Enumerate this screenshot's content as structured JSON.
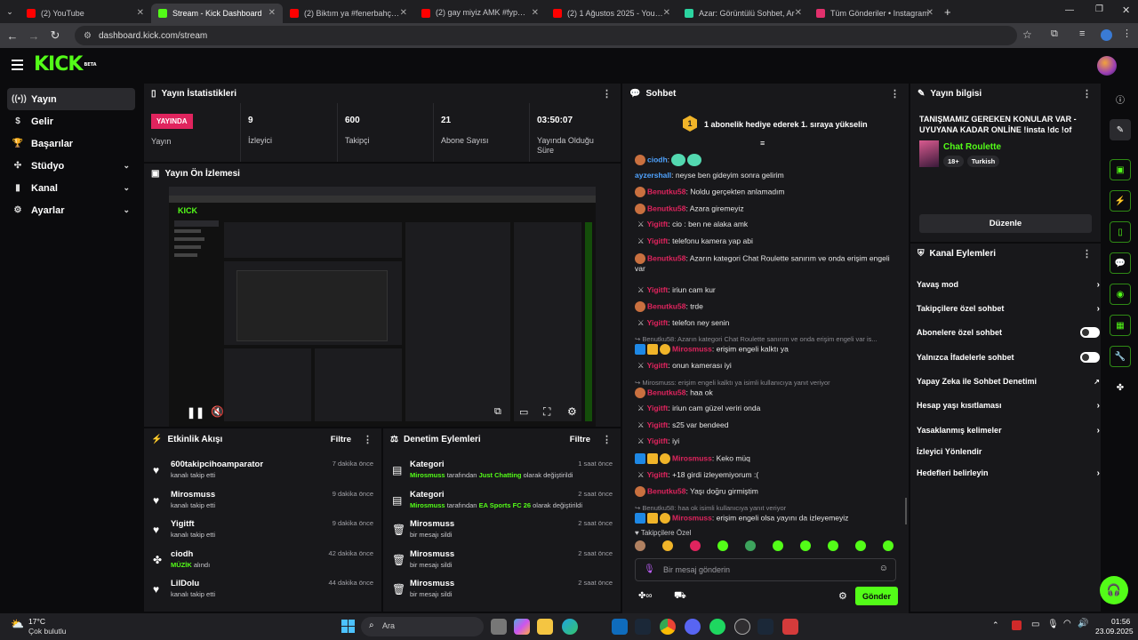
{
  "browser": {
    "tabs": [
      {
        "title": "(2) YouTube",
        "color": "#ff0000"
      },
      {
        "title": "Stream - Kick Dashboard",
        "color": "#53fc18"
      },
      {
        "title": "(2) Biktım ya #fenerbahçe #derı",
        "color": "#ff0000"
      },
      {
        "title": "(2) gay miyiz AMK #fyp🎶#viral",
        "color": "#ff0000"
      },
      {
        "title": "(2) 1 Ağustos 2025 - YouTube",
        "color": "#ff0000"
      },
      {
        "title": "Azar: Görüntülü Sohbet, Ar",
        "color": "#2bd4a0"
      },
      {
        "title": "Tüm Gönderiler • Instagram",
        "color": "#e1306c"
      }
    ],
    "active_tab": 1,
    "url": "dashboard.kick.com/stream"
  },
  "brand": {
    "logo": "KICK",
    "beta": "BETA",
    "accent": "#53fc18"
  },
  "sidebar": {
    "items": [
      {
        "label": "Yayın",
        "icon": "broadcast-icon",
        "glyph": "((•))",
        "active": true
      },
      {
        "label": "Gelir",
        "icon": "dollar-icon",
        "glyph": "$"
      },
      {
        "label": "Başarılar",
        "icon": "trophy-icon",
        "glyph": "🏆"
      },
      {
        "label": "Stüdyo",
        "icon": "studio-icon",
        "glyph": "✣",
        "expandable": true
      },
      {
        "label": "Kanal",
        "icon": "chart-icon",
        "glyph": "▮",
        "expandable": true
      },
      {
        "label": "Ayarlar",
        "icon": "gear-icon",
        "glyph": "⚙",
        "expandable": true
      }
    ]
  },
  "stats": {
    "title": "Yayın İstatistikleri",
    "live_badge": "YAYINDA",
    "live_label": "Yayın",
    "items": [
      {
        "value": "9",
        "label": "İzleyici"
      },
      {
        "value": "600",
        "label": "Takipçi"
      },
      {
        "value": "21",
        "label": "Abone Sayısı"
      },
      {
        "value": "03:50:07",
        "label": "Yayında Olduğu Süre"
      }
    ]
  },
  "preview": {
    "title": "Yayın Ön İzlemesi"
  },
  "activity": {
    "title": "Etkinlik Akışı",
    "filter": "Filtre",
    "items": [
      {
        "name": "600takipcihoamparator",
        "desc": "kanalı takip etti",
        "time": "7 dakika önce",
        "icon": "heart-icon",
        "glyph": "♥"
      },
      {
        "name": "Mirosmuss",
        "desc": "kanalı takip etti",
        "time": "9 dakika önce",
        "icon": "heart-icon",
        "glyph": "♥"
      },
      {
        "name": "Yigitft",
        "desc": "kanalı takip etti",
        "time": "9 dakika önce",
        "icon": "heart-icon",
        "glyph": "♥"
      },
      {
        "name": "ciodh",
        "desc_green": "MÜZİK",
        "desc": " alındı",
        "time": "42 dakika önce",
        "icon": "gift-icon",
        "glyph": "✤"
      },
      {
        "name": "LilDolu",
        "desc": "kanalı takip etti",
        "time": "44 dakika önce",
        "icon": "heart-icon",
        "glyph": "♥"
      }
    ]
  },
  "moderation": {
    "title": "Denetim Eylemleri",
    "filter": "Filtre",
    "items": [
      {
        "name": "Kategori",
        "user": "Mirosmuss",
        "mid": " tarafından ",
        "target": "Just Chatting",
        "end": " olarak değiştirildi",
        "time": "1 saat önce",
        "icon": "category-icon",
        "glyph": "▤"
      },
      {
        "name": "Kategori",
        "user": "Mirosmuss",
        "mid": " tarafından ",
        "target": "EA Sports FC 26",
        "end": " olarak değiştirildi",
        "time": "2 saat önce",
        "icon": "category-icon",
        "glyph": "▤"
      },
      {
        "name": "Mirosmuss",
        "plain": "bir mesajı sildi",
        "time": "2 saat önce",
        "icon": "trash-icon",
        "glyph": "🗑"
      },
      {
        "name": "Mirosmuss",
        "plain": "bir mesajı sildi",
        "time": "2 saat önce",
        "icon": "trash-icon",
        "glyph": "🗑"
      },
      {
        "name": "Mirosmuss",
        "plain": "bir mesajı sildi",
        "time": "2 saat önce",
        "icon": "trash-icon",
        "glyph": "🗑"
      }
    ]
  },
  "chat": {
    "title": "Sohbet",
    "pinned": "1 abonelik hediye ederek 1. sıraya yükselin",
    "pinned_rank": "1",
    "messages": [
      {
        "user": "ciodh",
        "color": "#4fa3ff",
        "text": ":",
        "badge": "avatar"
      },
      {
        "user": "ayzershall",
        "color": "#4fa3ff",
        "text": ": neyse ben gideyim sonra gelirim",
        "badge": "none"
      },
      {
        "user": "Benutku58",
        "color": "#e0245e",
        "text": ": Noldu gerçekten anlamadım",
        "badge": "avatar"
      },
      {
        "user": "Benutku58",
        "color": "#e0245e",
        "text": ": Azara giremeyiz",
        "badge": "avatar"
      },
      {
        "user": "Yigitft",
        "color": "#e0245e",
        "text": ": cio : ben ne alaka amk",
        "badge": "sword"
      },
      {
        "user": "Yigitft",
        "color": "#e0245e",
        "text": ": telefonu kamera yap abi",
        "badge": "sword"
      },
      {
        "user": "Benutku58",
        "color": "#e0245e",
        "text": ": Azarın kategori Chat Roulette sanırım ve onda erişim engeli var",
        "badge": "avatar"
      },
      {
        "user": "Yigitft",
        "color": "#e0245e",
        "text": ": iriun cam kur",
        "badge": "sword"
      },
      {
        "user": "Benutku58",
        "color": "#e0245e",
        "text": ": trde",
        "badge": "avatar"
      },
      {
        "user": "Yigitft",
        "color": "#e0245e",
        "text": ": telefon ney senin",
        "badge": "sword"
      },
      {
        "reply": "↪ Benutku58: Azarın kategori Chat Roulette sanırım ve onda erişim engeli var is..."
      },
      {
        "user": "Mirosmuss",
        "color": "#e0245e",
        "text": ": erişim engeli kalktı ya",
        "badge": "mod"
      },
      {
        "user": "Yigitft",
        "color": "#e0245e",
        "text": ": onun kamerası iyi",
        "badge": "sword"
      },
      {
        "reply": "↪ Mirosmuss: erişim engeli kalktı ya isimli kullanıcıya yanıt veriyor"
      },
      {
        "user": "Benutku58",
        "color": "#e0245e",
        "text": ": haa ok",
        "badge": "avatar"
      },
      {
        "user": "Yigitft",
        "color": "#e0245e",
        "text": ": iriun cam güzel veriri onda",
        "badge": "sword"
      },
      {
        "user": "Yigitft",
        "color": "#e0245e",
        "text": ": s25 var bendeed",
        "badge": "sword"
      },
      {
        "user": "Yigitft",
        "color": "#e0245e",
        "text": ": iyi",
        "badge": "sword"
      },
      {
        "user": "Mirosmuss",
        "color": "#e0245e",
        "text": ": Keko müq",
        "badge": "mod"
      },
      {
        "user": "Yigitft",
        "color": "#e0245e",
        "text": ": +18 girdi izleyemiyorum :(",
        "badge": "sword"
      },
      {
        "user": "Benutku58",
        "color": "#e0245e",
        "text": ": Yaşı doğru girmiştim",
        "badge": "avatar"
      },
      {
        "reply": "↪ Benutku58: haa ok isimli kullanıcıya yanıt veriyor"
      },
      {
        "user": "Mirosmuss",
        "color": "#e0245e",
        "text": ": erişim engeli olsa yayını da izleyemeyiz",
        "badge": "mod"
      }
    ],
    "followers_only": "Takipçilere Özel",
    "input_placeholder": "Bir mesaj gönderin",
    "send": "Gönder"
  },
  "stream_info": {
    "title": "Yayın bilgisi",
    "stream_title": "TANIŞMAMIZ GEREKEN KONULAR VAR - UYUYANA KADAR ONLİNE !insta !dc !of",
    "category": "Chat Roulette",
    "tags": [
      "18+",
      "Turkish"
    ],
    "edit": "Düzenle"
  },
  "channel_actions": {
    "title": "Kanal Eylemleri",
    "items": [
      {
        "label": "Yavaş mod",
        "control": "chevron"
      },
      {
        "label": "Takipçilere özel sohbet",
        "control": "chevron"
      },
      {
        "label": "Abonelere özel sohbet",
        "control": "toggle"
      },
      {
        "label": "Yalnızca İfadelerle sohbet",
        "control": "toggle"
      },
      {
        "label": "Yapay Zeka ile Sohbet Denetimi",
        "control": "external"
      },
      {
        "label": "Hesap yaşı kısıtlaması",
        "control": "chevron"
      },
      {
        "label": "Yasaklanmış kelimeler",
        "control": "chevron"
      },
      {
        "label": "İzleyici Yönlendir",
        "control": "none"
      },
      {
        "label": "Hedefleri belirleyin",
        "control": "chevron"
      }
    ]
  },
  "weather": {
    "temp": "17°C",
    "desc": "Çok bulutlu"
  },
  "taskbar": {
    "search": "Ara"
  },
  "clock": {
    "time": "01:56",
    "date": "23.09.2025"
  }
}
